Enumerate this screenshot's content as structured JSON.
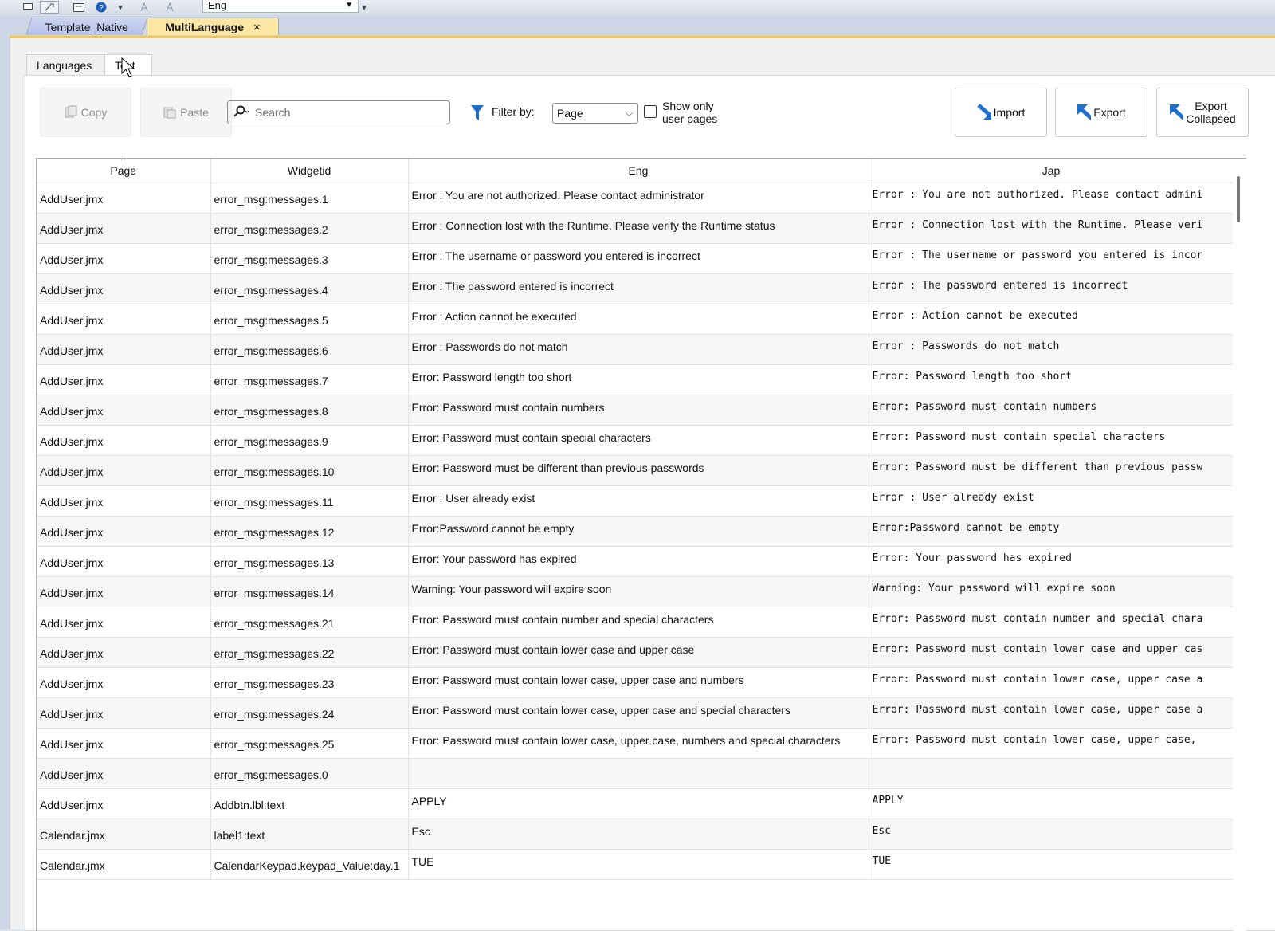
{
  "toolbar": {
    "language_value": "Eng",
    "icons": [
      "screen-icon",
      "tool-icon",
      "properties-icon",
      "help-icon",
      "toolbar-overflow-icon",
      "language-a-icon",
      "language-b-icon",
      "toolbar-overflow-icon"
    ]
  },
  "doc_tabs": {
    "items": [
      {
        "label": "Template_Native",
        "active": false
      },
      {
        "label": "MultiLanguage",
        "active": true
      }
    ],
    "close_glyph": "×"
  },
  "subtabs": {
    "languages": "Languages",
    "text": "Text"
  },
  "actions": {
    "copy": "Copy",
    "paste": "Paste",
    "search_placeholder": "Search",
    "filter_label": "Filter by:",
    "filter_value": "Page",
    "show_only_line1": "Show only",
    "show_only_line2": "user pages",
    "import": "Import",
    "export": "Export",
    "export_collapsed_line1": "Export",
    "export_collapsed_line2": "Collapsed"
  },
  "table": {
    "columns": [
      "Page",
      "Widgetid",
      "Eng",
      "Jap"
    ],
    "rows": [
      [
        "AddUser.jmx",
        "error_msg:messages.1",
        "Error : You are not authorized. Please contact administrator",
        "Error : You are not authorized. Please contact admini"
      ],
      [
        "AddUser.jmx",
        "error_msg:messages.2",
        "Error : Connection lost with the Runtime. Please verify the Runtime status",
        "Error : Connection lost with the Runtime. Please veri"
      ],
      [
        "AddUser.jmx",
        "error_msg:messages.3",
        "Error : The username or password you entered is incorrect",
        "Error : The username or password you entered is incor"
      ],
      [
        "AddUser.jmx",
        "error_msg:messages.4",
        "Error : The password entered is incorrect",
        "Error : The password entered is incorrect"
      ],
      [
        "AddUser.jmx",
        "error_msg:messages.5",
        "Error : Action cannot be executed",
        "Error : Action cannot be executed"
      ],
      [
        "AddUser.jmx",
        "error_msg:messages.6",
        "Error : Passwords do not match",
        "Error : Passwords do not match"
      ],
      [
        "AddUser.jmx",
        "error_msg:messages.7",
        "Error: Password length too short",
        "Error: Password length too short"
      ],
      [
        "AddUser.jmx",
        "error_msg:messages.8",
        "Error: Password must contain numbers",
        "Error: Password must contain numbers"
      ],
      [
        "AddUser.jmx",
        "error_msg:messages.9",
        "Error: Password must contain special characters",
        "Error: Password must contain special characters"
      ],
      [
        "AddUser.jmx",
        "error_msg:messages.10",
        "Error: Password must be different than previous passwords",
        "Error: Password must be different than previous passw"
      ],
      [
        "AddUser.jmx",
        "error_msg:messages.11",
        "Error : User already exist",
        "Error : User already exist"
      ],
      [
        "AddUser.jmx",
        "error_msg:messages.12",
        "Error:Password cannot be empty",
        "Error:Password cannot be empty"
      ],
      [
        "AddUser.jmx",
        "error_msg:messages.13",
        "Error: Your password has expired",
        "Error: Your password has expired"
      ],
      [
        "AddUser.jmx",
        "error_msg:messages.14",
        "Warning: Your password will expire soon",
        "Warning: Your password will expire soon"
      ],
      [
        "AddUser.jmx",
        "error_msg:messages.21",
        "Error: Password must contain number and special characters",
        "Error: Password must contain number and special chara"
      ],
      [
        "AddUser.jmx",
        "error_msg:messages.22",
        "Error: Password must contain lower case and upper case",
        "Error: Password must contain lower case and upper cas"
      ],
      [
        "AddUser.jmx",
        "error_msg:messages.23",
        "Error: Password must contain lower case, upper case and numbers",
        "Error: Password must contain lower case, upper case a"
      ],
      [
        "AddUser.jmx",
        "error_msg:messages.24",
        "Error: Password must contain lower case, upper case and special characters",
        "Error: Password must contain lower case, upper case a"
      ],
      [
        "AddUser.jmx",
        "error_msg:messages.25",
        "Error: Password must contain lower case, upper case, numbers and special characters",
        "Error: Password must contain lower case, upper case,"
      ],
      [
        "AddUser.jmx",
        "error_msg:messages.0",
        "",
        ""
      ],
      [
        "AddUser.jmx",
        "Addbtn.lbl:text",
        "APPLY",
        "APPLY"
      ],
      [
        "Calendar.jmx",
        "label1:text",
        "Esc",
        "Esc"
      ],
      [
        "Calendar.jmx",
        "CalendarKeypad.keypad_Value:day.1",
        "TUE",
        "TUE"
      ]
    ]
  }
}
